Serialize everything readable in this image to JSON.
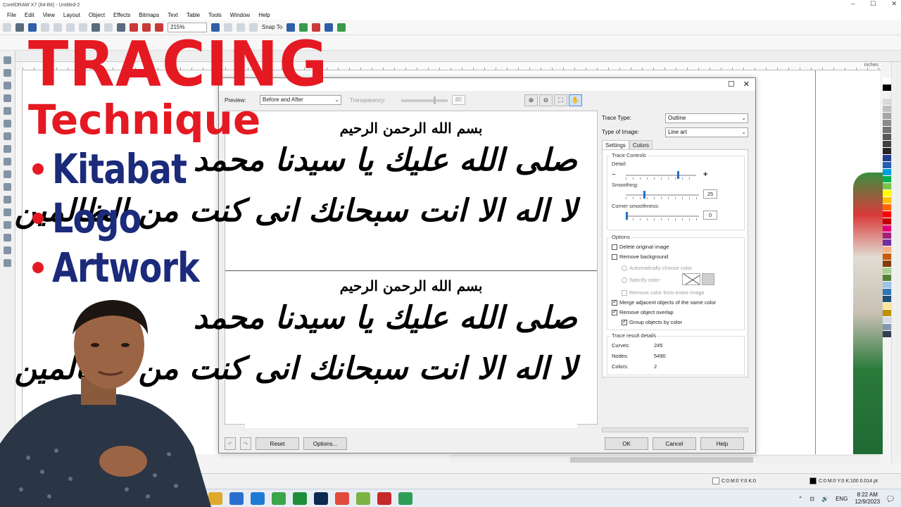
{
  "window": {
    "title": "CorelDRAW X7 (64-Bit) - Untitled-2"
  },
  "menu": [
    "File",
    "Edit",
    "View",
    "Layout",
    "Object",
    "Effects",
    "Bitmaps",
    "Text",
    "Table",
    "Tools",
    "Window",
    "Help"
  ],
  "toolbar": {
    "zoom": "215%",
    "snap_label": "Snap To"
  },
  "ruler": {
    "units": "inches"
  },
  "overlay": {
    "title": "TRACING",
    "subtitle": "Technique",
    "bullets": [
      "Kitabat",
      "Logo",
      "Artwork"
    ]
  },
  "dialog": {
    "preview_label": "Preview:",
    "preview_mode": "Before and After",
    "transparency_label": "Transparency:",
    "transparency_value": "80",
    "trace_type_label": "Trace Type:",
    "trace_type": "Outline",
    "image_type_label": "Type of Image:",
    "image_type": "Line art",
    "tabs": [
      "Settings",
      "Colors"
    ],
    "trace_controls_title": "Trace Controls",
    "detail_label": "Detail:",
    "detail_fraction": 0.75,
    "smoothing_label": "Smoothing:",
    "smoothing_value": "25",
    "smoothing_fraction": 0.25,
    "corner_label": "Corner smoothness:",
    "corner_value": "0",
    "corner_fraction": 0.0,
    "options_title": "Options",
    "opt_delete_original": "Delete original image",
    "opt_remove_background": "Remove background",
    "opt_auto_color": "Automatically choose color",
    "opt_specify_color": "Specify color:",
    "opt_remove_color_entire": "Remove color from entire image",
    "opt_merge_adjacent": "Merge adjacent objects of the same color",
    "opt_remove_overlap": "Remove object overlap",
    "opt_group_by_color": "Group objects by color",
    "details_title": "Trace result details",
    "curves_label": "Curves:",
    "curves_value": "245",
    "nodes_label": "Nodes:",
    "nodes_value": "5490",
    "colors_label": "Colors:",
    "colors_value": "2",
    "btn_reset": "Reset",
    "btn_options": "Options...",
    "btn_ok": "OK",
    "btn_cancel": "Cancel",
    "btn_help": "Help"
  },
  "calligraphy": {
    "line1": "بسم الله الرحمن الرحيم",
    "line2": "صلى الله عليك يا سيدنا محمد",
    "line3": "لا اله الا انت سبحانك انى كنت من الظالمين"
  },
  "status": {
    "fill_text": "C:0 M:0 Y:0 K:0",
    "outline_text": "C:0 M:0 Y:0 K:100  0.014 pt"
  },
  "taskbar": {
    "lang": "ENG",
    "time": "8:22 AM",
    "date": "12/9/2023"
  },
  "palette_colors": [
    "#ffffff",
    "#000000",
    "#f2f2f2",
    "#d9d9d9",
    "#bfbfbf",
    "#a6a6a6",
    "#8c8c8c",
    "#737373",
    "#595959",
    "#404040",
    "#262626",
    "#1f3e8c",
    "#2a5db0",
    "#00a0e0",
    "#00b050",
    "#7ec24a",
    "#ffff00",
    "#ffc000",
    "#ff6600",
    "#ff0000",
    "#c00000",
    "#e2007a",
    "#a0207a",
    "#7030a0",
    "#f4b183",
    "#c55a11",
    "#843c0c",
    "#a9d18e",
    "#548235",
    "#9dc3e6",
    "#2e75b6",
    "#1f4e79",
    "#ffe699",
    "#bf9000",
    "#d6dce5",
    "#8497b0",
    "#333f50"
  ]
}
